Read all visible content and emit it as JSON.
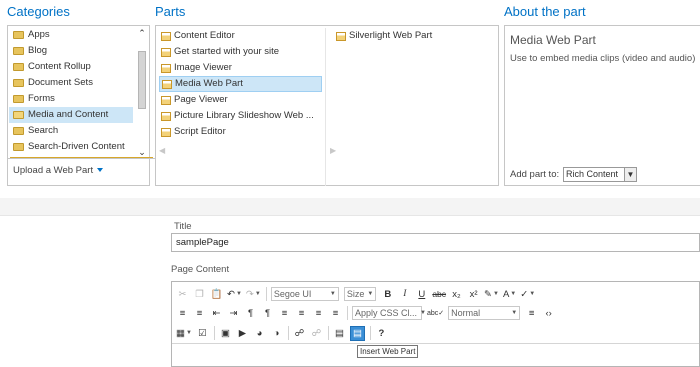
{
  "gallery": {
    "categories": {
      "heading": "Categories",
      "items": [
        {
          "label": "Apps"
        },
        {
          "label": "Blog"
        },
        {
          "label": "Content Rollup"
        },
        {
          "label": "Document Sets"
        },
        {
          "label": "Forms"
        },
        {
          "label": "Media and Content",
          "selected": true
        },
        {
          "label": "Search"
        },
        {
          "label": "Search-Driven Content"
        }
      ],
      "upload_label": "Upload a Web Part"
    },
    "parts": {
      "heading": "Parts",
      "column1": [
        {
          "label": "Content Editor"
        },
        {
          "label": "Get started with your site"
        },
        {
          "label": "Image Viewer"
        },
        {
          "label": "Media Web Part",
          "selected": true
        },
        {
          "label": "Page Viewer"
        },
        {
          "label": "Picture Library Slideshow Web ..."
        },
        {
          "label": "Script Editor"
        }
      ],
      "column2": [
        {
          "label": "Silverlight Web Part"
        }
      ]
    },
    "about": {
      "heading": "About the part",
      "title": "Media Web Part",
      "description": "Use to embed media clips (video and audio)",
      "add_part_label": "Add part to:",
      "add_part_value": "Rich Content"
    }
  },
  "form": {
    "title_label": "Title",
    "title_value": "samplePage",
    "content_label": "Page Content"
  },
  "toolbar": {
    "font_family": "Segoe UI",
    "font_size": "Size",
    "bold": "B",
    "italic": "I",
    "underline": "U",
    "strikethrough": "abc",
    "subscript": "x₂",
    "superscript": "x²",
    "css_class": "Apply CSS Cl...",
    "paragraph_style": "Normal",
    "help": "?"
  },
  "tooltip": "Insert Web Part",
  "colors": {
    "accent": "#0072c6",
    "selection": "#cde6f7",
    "highlight_button": "#3b8fd6"
  }
}
